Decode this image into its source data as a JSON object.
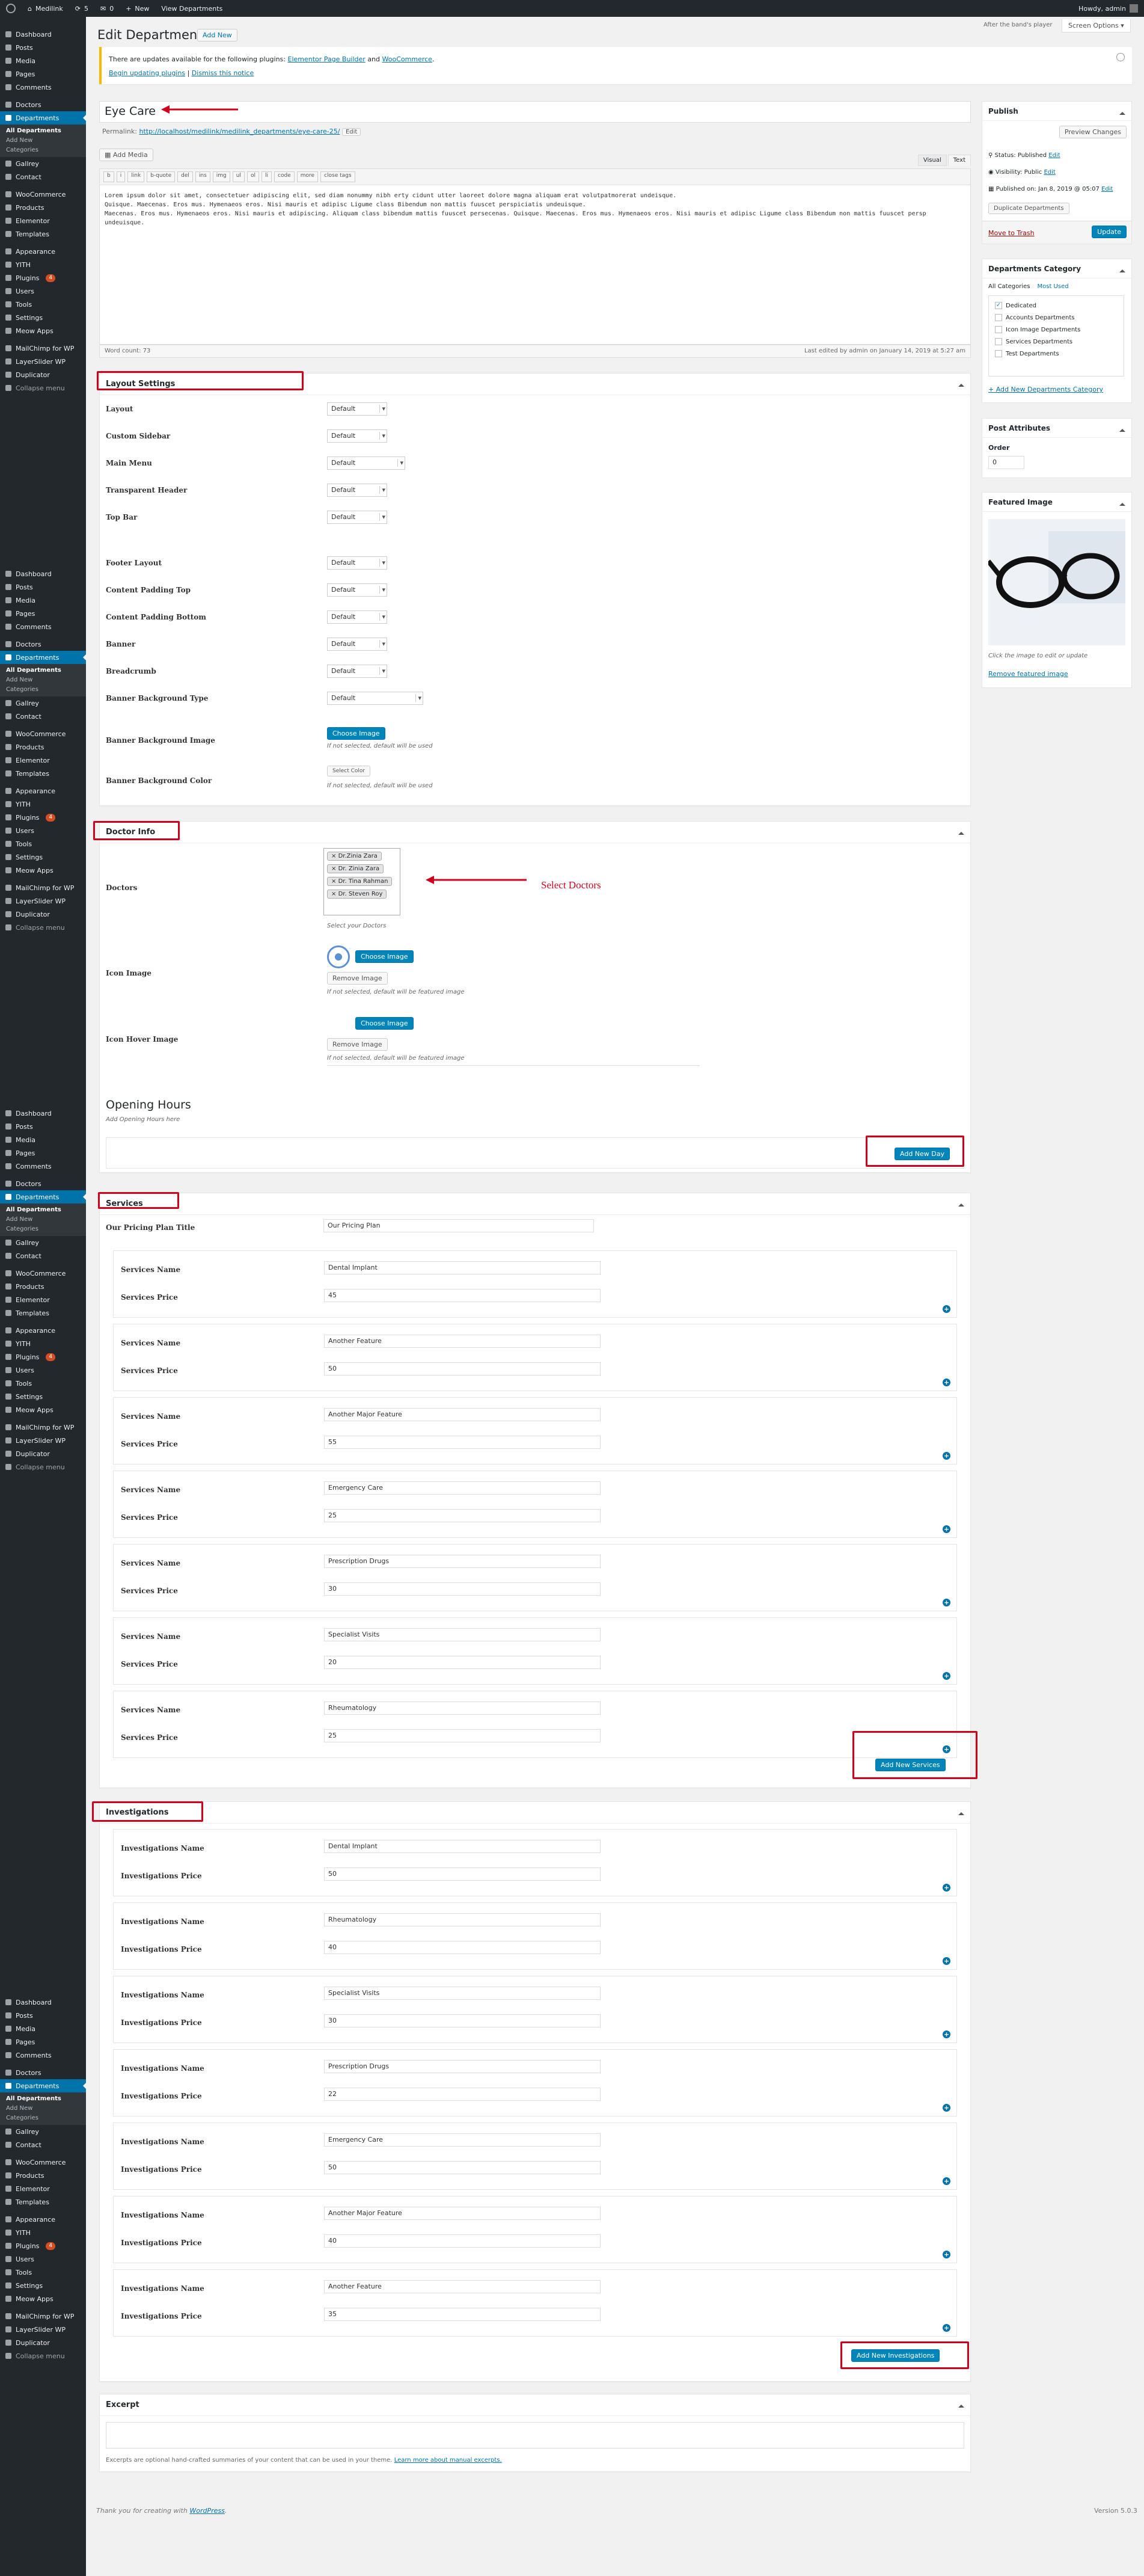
{
  "adminbar": {
    "site": "Medilink",
    "updates": "5",
    "comments": "0",
    "new": "New",
    "view": "View Departments",
    "howdy": "Howdy, admin"
  },
  "page": {
    "title": "Edit Departments",
    "add_new": "Add New",
    "hint": "After the band's player",
    "screen_options": "Screen Options"
  },
  "sidebar": {
    "items": [
      "Dashboard",
      "Posts",
      "Media",
      "Pages",
      "Comments",
      "Doctors",
      "Departments",
      "Gallrey",
      "Contact",
      "WooCommerce",
      "Products",
      "Elementor",
      "Templates",
      "Appearance",
      "YITH",
      "Plugins",
      "Users",
      "Tools",
      "Settings",
      "Meow Apps",
      "MailChimp for WP",
      "LayerSlider WP",
      "Duplicator",
      "Collapse menu"
    ],
    "submenu": [
      "All Departments",
      "Add New",
      "Categories"
    ],
    "plugins_count": "4"
  },
  "notice": {
    "text": "There are updates available for the following plugins:",
    "plugin1": "Elementor Page Builder",
    "and": "and",
    "plugin2": "WooCommerce",
    "link1": "Begin updating plugins",
    "divider": "|",
    "link2": "Dismiss this notice"
  },
  "post": {
    "title": "Eye Care",
    "permalink_label": "Permalink:",
    "permalink_url": "http://localhost/medilink/medilink_departments/eye-care-25/",
    "permalink_btn": "Edit",
    "add_media": "Add Media",
    "tab_visual": "Visual",
    "tab_text": "Text",
    "toolbar": [
      "b",
      "i",
      "link",
      "b-quote",
      "del",
      "ins",
      "img",
      "ul",
      "ol",
      "li",
      "code",
      "more",
      "close tags"
    ],
    "content": [
      "Lorem ipsum dolor sit amet, consectetuer adipiscing elit, sed diam nonummy nibh erty cidunt utter laoreet dolore magna aliquam erat volutpatmorerat undeisque.",
      "Quisque. Maecenas. Eros mus. Hymenaeos eros. Nisi mauris et adipisc Ligume class Bibendum non mattis fuuscet perspiciatis undeuisque.",
      "Maecenas. Eros mus. Hymenaeos eros. Nisi mauris et adipiscing. Aliquam class bibendum mattis fuuscet persecenas. Quisque. Maecenas. Eros mus. Hymenaeos eros. Nisi mauris et adipisc Ligume class Bibendum non mattis fuuscet persp undeuisque."
    ],
    "word_count": "Word count: 73",
    "last_edited": "Last edited by admin on January 14, 2019 at 5:27 am"
  },
  "layout": {
    "heading": "Layout Settings",
    "rows": [
      {
        "label": "Layout",
        "value": "Default"
      },
      {
        "label": "Custom Sidebar",
        "value": "Default"
      },
      {
        "label": "Main Menu",
        "value": "Default"
      },
      {
        "label": "Transparent Header",
        "value": "Default"
      },
      {
        "label": "Top Bar",
        "value": "Default"
      },
      {
        "label": "Footer Layout",
        "value": "Default"
      },
      {
        "label": "Content Padding Top",
        "value": "Default"
      },
      {
        "label": "Content Padding Bottom",
        "value": "Default"
      },
      {
        "label": "Banner",
        "value": "Default"
      },
      {
        "label": "Breadcrumb",
        "value": "Default"
      },
      {
        "label": "Banner Background Type",
        "value": "Default"
      }
    ],
    "bg_image_label": "Banner Background Image",
    "choose_image": "Choose Image",
    "bg_note": "If not selected, default will be used",
    "bg_color_label": "Banner Background Color",
    "select_color": "Select Color",
    "color_note": "If not selected, default will be used"
  },
  "doctor": {
    "heading": "Doctor Info",
    "doctors_label": "Doctors",
    "doctors": [
      "Dr.Zinia Zara",
      "Dr. Zinia Zara",
      "Dr. Tina Rahman",
      "Dr. Steven Roy"
    ],
    "select_note": "Select your Doctors",
    "annotation": "Select Doctors",
    "icon_label": "Icon Image",
    "choose": "Choose Image",
    "remove": "Remove Image",
    "icon_note": "If not selected, default will be featured image",
    "hover_label": "Icon Hover Image",
    "hover_note": "If not selected, default will be featured image",
    "opening_title": "Opening Hours",
    "opening_note": "Add Opening Hours here",
    "add_day": "Add New Day"
  },
  "services": {
    "heading": "Services",
    "plan_label": "Our Pricing Plan Title",
    "plan_value": "Our Pricing Plan",
    "name_label": "Services Name",
    "price_label": "Services Price",
    "items": [
      {
        "name": "Dental Implant",
        "price": "45"
      },
      {
        "name": "Another Feature",
        "price": "50"
      },
      {
        "name": "Another Major Feature",
        "price": "55"
      },
      {
        "name": "Emergency Care",
        "price": "25"
      },
      {
        "name": "Prescription Drugs",
        "price": "30"
      },
      {
        "name": "Specialist Visits",
        "price": "20"
      },
      {
        "name": "Rheumatology",
        "price": "25"
      }
    ],
    "add_btn": "Add New Services"
  },
  "investigations": {
    "heading": "Investigations",
    "name_label": "Investigations Name",
    "price_label": "Investigations Price",
    "items": [
      {
        "name": "Dental Implant",
        "price": "50"
      },
      {
        "name": "Rheumatology",
        "price": "40"
      },
      {
        "name": "Specialist Visits",
        "price": "30"
      },
      {
        "name": "Prescription Drugs",
        "price": "22"
      },
      {
        "name": "Emergency Care",
        "price": "50"
      },
      {
        "name": "Another Major Feature",
        "price": "40"
      },
      {
        "name": "Another Feature",
        "price": "35"
      }
    ],
    "add_btn": "Add New Investigations"
  },
  "excerpt": {
    "heading": "Excerpt",
    "note": "Excerpts are optional hand-crafted summaries of your content that can be used in your theme.",
    "link": "Learn more about manual excerpts."
  },
  "publish": {
    "heading": "Publish",
    "preview": "Preview Changes",
    "status": "Status: Published",
    "status_edit": "Edit",
    "visibility": "Visibility: Public",
    "visibility_edit": "Edit",
    "published_on": "Published on: Jan 8, 2019 @ 05:07",
    "published_edit": "Edit",
    "duplicate": "Duplicate Departments",
    "trash": "Move to Trash",
    "update": "Update"
  },
  "category": {
    "heading": "Departments Category",
    "tab_all": "All Categories",
    "tab_used": "Most Used",
    "items": [
      {
        "name": "Dedicated",
        "checked": true
      },
      {
        "name": "Accounts Departments",
        "checked": false
      },
      {
        "name": "Icon Image Departments",
        "checked": false
      },
      {
        "name": "Services Departments",
        "checked": false
      },
      {
        "name": "Test Departments",
        "checked": false
      }
    ],
    "add_new": "+ Add New Departments Category"
  },
  "attributes": {
    "heading": "Post Attributes",
    "order_label": "Order",
    "order_value": "0"
  },
  "featured": {
    "heading": "Featured Image",
    "note": "Click the image to edit or update",
    "remove": "Remove featured image"
  },
  "footer": {
    "text": "Thank you for creating with",
    "link": "WordPress",
    "version": "Version 5.0.3"
  }
}
